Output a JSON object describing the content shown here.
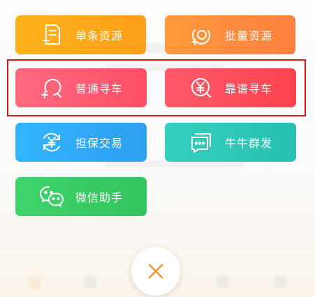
{
  "menu": {
    "items": [
      {
        "label": "单条资源",
        "icon": "document-add-icon",
        "color": "#ffb21b"
      },
      {
        "label": "批量资源",
        "icon": "refresh-circle-icon",
        "color": "#ff8c3c"
      },
      {
        "label": "普通寻车",
        "icon": "search-add-icon",
        "color": "#ff5a70"
      },
      {
        "label": "靠谱寻车",
        "icon": "yen-search-icon",
        "color": "#ff4a58"
      },
      {
        "label": "担保交易",
        "icon": "yen-cycle-icon",
        "color": "#33aaf8"
      },
      {
        "label": "牛牛群发",
        "icon": "chat-stack-icon",
        "color": "#2ec8b8"
      },
      {
        "label": "微信助手",
        "icon": "wechat-icon",
        "color": "#38cc63"
      }
    ]
  },
  "close": {
    "icon": "close-icon",
    "color": "#f0922e"
  },
  "highlight": {
    "color": "#d81b1b"
  }
}
